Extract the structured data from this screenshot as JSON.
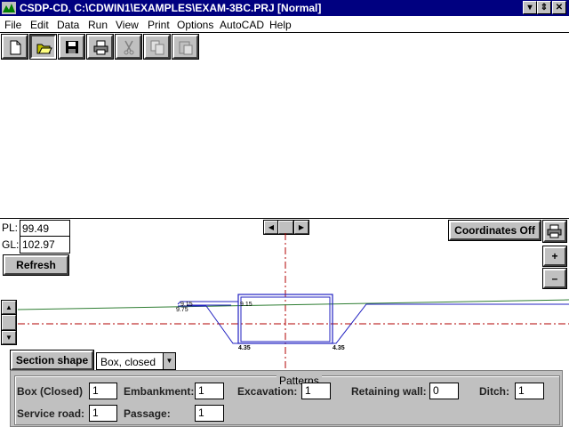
{
  "window": {
    "title": "CSDP-CD, C:\\CDWIN1\\EXAMPLES\\EXAM-3BC.PRJ [Normal]"
  },
  "menu": [
    {
      "label": "File"
    },
    {
      "label": "Edit"
    },
    {
      "label": "Data"
    },
    {
      "label": "Run"
    },
    {
      "label": "View"
    },
    {
      "label": "Print"
    },
    {
      "label": "Options"
    },
    {
      "label": "AutoCAD"
    },
    {
      "label": "Help"
    }
  ],
  "toolbar": {
    "icons": [
      "new-file-icon",
      "open-folder-icon",
      "save-disk-icon",
      "printer-icon",
      "cut-scissors-icon",
      "copy-icon",
      "paste-icon"
    ]
  },
  "levels": {
    "pl_label": "PL:",
    "pl_value": "99.49",
    "gl_label": "GL:",
    "gl_value": "102.97",
    "refresh_label": "Refresh"
  },
  "view_controls": {
    "coordinates_label": "Coordinates Off",
    "zoom_in": "+",
    "zoom_out": "–"
  },
  "drawing": {
    "labels": {
      "top_left": "9.15",
      "top_left_sub": "9.75",
      "box_top": "9.15",
      "bottom_left": "4.35",
      "bottom_right": "4.35"
    },
    "colors": {
      "ground_line": "#2e7d32",
      "section": "#2020c0",
      "centerline": "#b00000"
    }
  },
  "section": {
    "button_label": "Section shape",
    "select_value": "Box, closed"
  },
  "patterns": {
    "title": "Patterns",
    "items": [
      {
        "label": "Box (Closed)",
        "value": "1"
      },
      {
        "label": "Embankment:",
        "value": "1"
      },
      {
        "label": "Excavation:",
        "value": "1"
      },
      {
        "label": "Retaining wall:",
        "value": "0"
      },
      {
        "label": "Ditch:",
        "value": "1"
      },
      {
        "label": "Service road:",
        "value": "1"
      },
      {
        "label": "Passage:",
        "value": "1"
      }
    ]
  }
}
